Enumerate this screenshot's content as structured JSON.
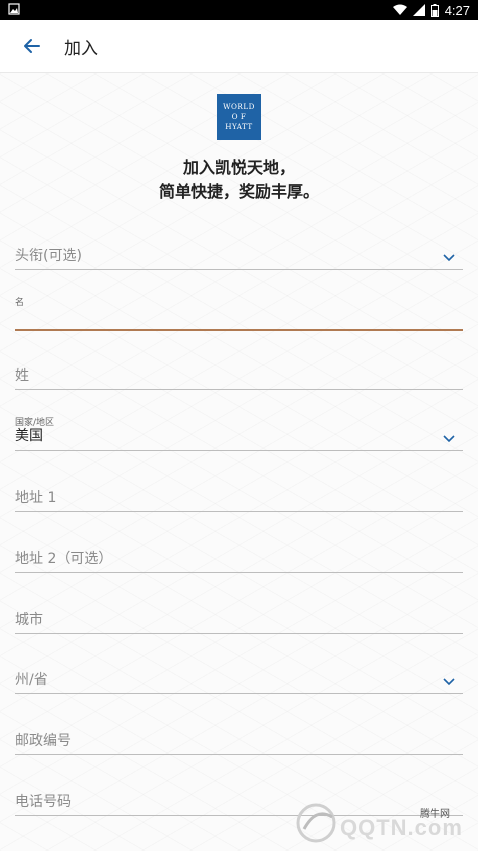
{
  "status_bar": {
    "time": "4:27"
  },
  "app_bar": {
    "title": "加入"
  },
  "logo": {
    "line1": "WORLD",
    "line2": "O F",
    "line3": "HYATT",
    "color": "#1f63a6"
  },
  "headline": {
    "line1": "加入凯悦天地，",
    "line2": "简单快捷，奖励丰厚。"
  },
  "form": {
    "title_field": {
      "placeholder": "头衔(可选)"
    },
    "first_name": {
      "label": "名",
      "value": ""
    },
    "last_name": {
      "placeholder": "姓"
    },
    "country": {
      "label": "国家/地区",
      "value": "美国"
    },
    "address1": {
      "placeholder": "地址 1"
    },
    "address2": {
      "placeholder": "地址 2（可选）"
    },
    "city": {
      "placeholder": "城市"
    },
    "state": {
      "placeholder": "州/省"
    },
    "postal": {
      "placeholder": "邮政编号"
    },
    "phone": {
      "placeholder": "电话号码"
    }
  },
  "watermark": {
    "small": "腾牛网",
    "big": "QQTN.com"
  },
  "colors": {
    "accent": "#1f63a6",
    "focus_underline": "#b07a52"
  }
}
